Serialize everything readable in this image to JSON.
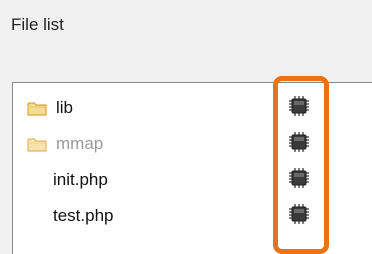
{
  "panel": {
    "title": "File list"
  },
  "files": [
    {
      "name": "lib",
      "type": "folder",
      "dimmed": false,
      "icon": "folder-icon",
      "action_icon": "chip-icon"
    },
    {
      "name": "mmap",
      "type": "folder",
      "dimmed": true,
      "icon": "folder-icon",
      "action_icon": "chip-icon"
    },
    {
      "name": "init.php",
      "type": "file",
      "dimmed": false,
      "icon": "",
      "action_icon": "chip-icon"
    },
    {
      "name": "test.php",
      "type": "file",
      "dimmed": false,
      "icon": "",
      "action_icon": "chip-icon"
    }
  ],
  "colors": {
    "highlight": "#e8731a",
    "folder": "#f3d58a",
    "chip": "#3a3a3a"
  }
}
